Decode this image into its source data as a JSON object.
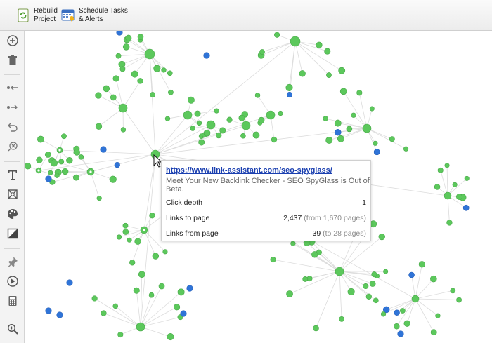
{
  "toolbar": {
    "rebuild": {
      "label": "Rebuild\nProject",
      "icon": "refresh-icon"
    },
    "schedule": {
      "label": "Schedule Tasks\n& Alerts",
      "icon": "calendar-icon"
    }
  },
  "sidebar": {
    "tools": [
      "add-icon",
      "delete-icon",
      "collapse-incoming-icon",
      "expand-outgoing-icon",
      "undo-icon",
      "remove-link-icon",
      "text-icon",
      "fit-graph-icon",
      "palette-icon",
      "contrast-icon",
      "pin-icon",
      "play-icon",
      "calculator-icon",
      "zoom-icon"
    ]
  },
  "colors": {
    "node": "#5cc85c",
    "node_stroke": "#4aa84a",
    "node_external": "#2f74d8",
    "edge": "#dcdcdc",
    "link": "#1a3fb0"
  },
  "tooltip": {
    "url": "https://www.link-assistant.com/seo-spyglass/",
    "title": "Meet Your New Backlink Checker - SEO SpyGlass is Out of Beta.",
    "rows": [
      {
        "key": "Click depth",
        "value": "1",
        "sub": ""
      },
      {
        "key": "Links to page",
        "value": "2,437",
        "sub": "(from 1,670 pages)"
      },
      {
        "key": "Links from page",
        "value": "39",
        "sub": "(to 28 pages)"
      }
    ]
  }
}
